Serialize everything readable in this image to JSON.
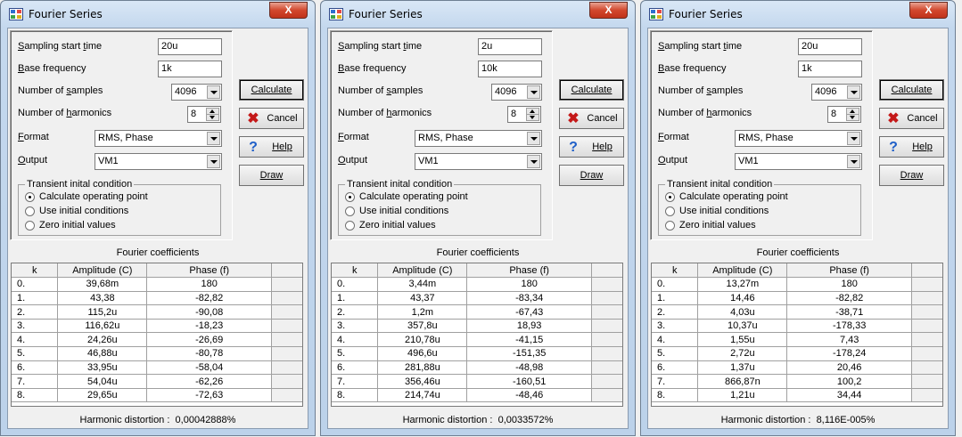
{
  "windows": [
    {
      "title": "Fourier Series",
      "close_label": "X",
      "labels": {
        "sampling_start_time": [
          "S",
          "ampling start ",
          "t",
          "ime"
        ],
        "base_frequency": [
          "B",
          "ase frequency"
        ],
        "number_of_samples": [
          "Number of ",
          "s",
          "amples"
        ],
        "number_of_harmonics": [
          "Number of ",
          "h",
          "armonics"
        ],
        "format": [
          "F",
          "ormat"
        ],
        "output": [
          "O",
          "utput"
        ]
      },
      "sampling_start_time": "20u",
      "base_frequency": "1k",
      "number_of_samples": "4096",
      "number_of_harmonics": "8",
      "format": "RMS, Phase",
      "output": "VM1",
      "transient_title": "Transient inital condition",
      "transient_options": [
        {
          "label": "Calculate operating point",
          "selected": true
        },
        {
          "label": "Use initial conditions",
          "selected": false
        },
        {
          "label": "Zero initial values",
          "selected": false
        }
      ],
      "buttons": {
        "calculate": "Calculate",
        "cancel": "Cancel",
        "help": "Help",
        "draw": "Draw"
      },
      "coef_title": "Fourier coefficients",
      "columns": [
        "k",
        "Amplitude (C)",
        "Phase (f)"
      ],
      "rows": [
        [
          "0.",
          "39,68m",
          "180"
        ],
        [
          "1.",
          "43,38",
          "-82,82"
        ],
        [
          "2.",
          "115,2u",
          "-90,08"
        ],
        [
          "3.",
          "116,62u",
          "-18,23"
        ],
        [
          "4.",
          "24,26u",
          "-26,69"
        ],
        [
          "5.",
          "46,88u",
          "-80,78"
        ],
        [
          "6.",
          "33,95u",
          "-58,04"
        ],
        [
          "7.",
          "54,04u",
          "-62,26"
        ],
        [
          "8.",
          "29,65u",
          "-72,63"
        ]
      ],
      "distortion_label": "Harmonic distortion :",
      "distortion_value": "0,00042888%"
    },
    {
      "title": "Fourier Series",
      "close_label": "X",
      "labels": {
        "sampling_start_time": [
          "S",
          "ampling start ",
          "t",
          "ime"
        ],
        "base_frequency": [
          "B",
          "ase frequency"
        ],
        "number_of_samples": [
          "Number of ",
          "s",
          "amples"
        ],
        "number_of_harmonics": [
          "Number of ",
          "h",
          "armonics"
        ],
        "format": [
          "F",
          "ormat"
        ],
        "output": [
          "O",
          "utput"
        ]
      },
      "sampling_start_time": "2u",
      "base_frequency": "10k",
      "number_of_samples": "4096",
      "number_of_harmonics": "8",
      "format": "RMS, Phase",
      "output": "VM1",
      "transient_title": "Transient inital condition",
      "transient_options": [
        {
          "label": "Calculate operating point",
          "selected": true
        },
        {
          "label": "Use initial conditions",
          "selected": false
        },
        {
          "label": "Zero initial values",
          "selected": false
        }
      ],
      "buttons": {
        "calculate": "Calculate",
        "cancel": "Cancel",
        "help": "Help",
        "draw": "Draw"
      },
      "coef_title": "Fourier coefficients",
      "columns": [
        "k",
        "Amplitude (C)",
        "Phase (f)"
      ],
      "rows": [
        [
          "0.",
          "3,44m",
          "180"
        ],
        [
          "1.",
          "43,37",
          "-83,34"
        ],
        [
          "2.",
          "1,2m",
          "-67,43"
        ],
        [
          "3.",
          "357,8u",
          "18,93"
        ],
        [
          "4.",
          "210,78u",
          "-41,15"
        ],
        [
          "5.",
          "496,6u",
          "-151,35"
        ],
        [
          "6.",
          "281,88u",
          "-48,98"
        ],
        [
          "7.",
          "356,46u",
          "-160,51"
        ],
        [
          "8.",
          "214,74u",
          "-48,46"
        ]
      ],
      "distortion_label": "Harmonic distortion :",
      "distortion_value": "0,0033572%"
    },
    {
      "title": "Fourier Series",
      "close_label": "X",
      "labels": {
        "sampling_start_time": [
          "S",
          "ampling start ",
          "t",
          "ime"
        ],
        "base_frequency": [
          "B",
          "ase frequency"
        ],
        "number_of_samples": [
          "Number of ",
          "s",
          "amples"
        ],
        "number_of_harmonics": [
          "Number of ",
          "h",
          "armonics"
        ],
        "format": [
          "F",
          "ormat"
        ],
        "output": [
          "O",
          "utput"
        ]
      },
      "sampling_start_time": "20u",
      "base_frequency": "1k",
      "number_of_samples": "4096",
      "number_of_harmonics": "8",
      "format": "RMS, Phase",
      "output": "VM1",
      "transient_title": "Transient inital condition",
      "transient_options": [
        {
          "label": "Calculate operating point",
          "selected": true
        },
        {
          "label": "Use initial conditions",
          "selected": false
        },
        {
          "label": "Zero initial values",
          "selected": false
        }
      ],
      "buttons": {
        "calculate": "Calculate",
        "cancel": "Cancel",
        "help": "Help",
        "draw": "Draw"
      },
      "coef_title": "Fourier coefficients",
      "columns": [
        "k",
        "Amplitude (C)",
        "Phase (f)"
      ],
      "rows": [
        [
          "0.",
          "13,27m",
          "180"
        ],
        [
          "1.",
          "14,46",
          "-82,82"
        ],
        [
          "2.",
          "4,03u",
          "-38,71"
        ],
        [
          "3.",
          "10,37u",
          "-178,33"
        ],
        [
          "4.",
          "1,55u",
          "7,43"
        ],
        [
          "5.",
          "2,72u",
          "-178,24"
        ],
        [
          "6.",
          "1,37u",
          "20,46"
        ],
        [
          "7.",
          "866,87n",
          "100,2"
        ],
        [
          "8.",
          "1,21u",
          "34,44"
        ]
      ],
      "distortion_label": "Harmonic distortion :",
      "distortion_value": "8,116E-005%"
    }
  ]
}
